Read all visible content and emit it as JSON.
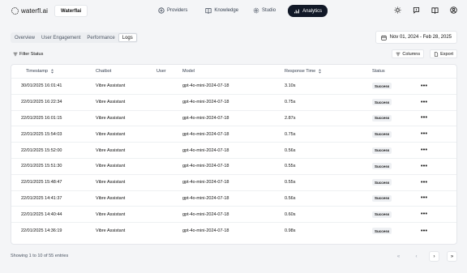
{
  "brand": {
    "logo_text": "waterfl.ai",
    "workspace": "Waterflai"
  },
  "nav": {
    "items": [
      {
        "label": "Providers",
        "icon": "circle-plus-icon"
      },
      {
        "label": "Knowledge",
        "icon": "book-icon"
      },
      {
        "label": "Studio",
        "icon": "gear-icon"
      },
      {
        "label": "Analytics",
        "icon": "chart-icon",
        "active": true
      }
    ]
  },
  "top_icons": [
    "sun-icon",
    "chat-alert-icon",
    "book-open-icon",
    "user-circle-icon"
  ],
  "tabs": [
    {
      "label": "Overview"
    },
    {
      "label": "User Engagement"
    },
    {
      "label": "Performance"
    },
    {
      "label": "Logs",
      "active": true
    }
  ],
  "date_range": "Nov 01, 2024 - Feb 28, 2025",
  "toolbar": {
    "filter_label": "Filter Status",
    "columns_label": "Columns",
    "export_label": "Export"
  },
  "table": {
    "headers": [
      "Timestamp",
      "Chatbot",
      "User",
      "Model",
      "Response Time",
      "Status"
    ],
    "rows": [
      {
        "timestamp": "30/01/2025 16:01:41",
        "chatbot": "Vibre Assistant",
        "user": "",
        "model": "gpt-4o-mini-2024-07-18",
        "response_time": "3.10s",
        "status": "Success"
      },
      {
        "timestamp": "22/01/2025 16:22:34",
        "chatbot": "Vibre Assistant",
        "user": "",
        "model": "gpt-4o-mini-2024-07-18",
        "response_time": "0.75s",
        "status": "Success"
      },
      {
        "timestamp": "22/01/2025 16:01:15",
        "chatbot": "Vibre Assistant",
        "user": "",
        "model": "gpt-4o-mini-2024-07-18",
        "response_time": "2.87s",
        "status": "Success"
      },
      {
        "timestamp": "22/01/2025 15:54:03",
        "chatbot": "Vibre Assistant",
        "user": "",
        "model": "gpt-4o-mini-2024-07-18",
        "response_time": "0.75s",
        "status": "Success"
      },
      {
        "timestamp": "22/01/2025 15:52:00",
        "chatbot": "Vibre Assistant",
        "user": "",
        "model": "gpt-4o-mini-2024-07-18",
        "response_time": "0.56s",
        "status": "Success"
      },
      {
        "timestamp": "22/01/2025 15:51:30",
        "chatbot": "Vibre Assistant",
        "user": "",
        "model": "gpt-4o-mini-2024-07-18",
        "response_time": "0.55s",
        "status": "Success"
      },
      {
        "timestamp": "22/01/2025 15:48:47",
        "chatbot": "Vibre Assistant",
        "user": "",
        "model": "gpt-4o-mini-2024-07-18",
        "response_time": "0.55s",
        "status": "Success"
      },
      {
        "timestamp": "22/01/2025 14:41:37",
        "chatbot": "Vibre Assistant",
        "user": "",
        "model": "gpt-4o-mini-2024-07-18",
        "response_time": "0.56s",
        "status": "Success"
      },
      {
        "timestamp": "22/01/2025 14:40:44",
        "chatbot": "Vibre Assistant",
        "user": "",
        "model": "gpt-4o-mini-2024-07-18",
        "response_time": "0.60s",
        "status": "Success"
      },
      {
        "timestamp": "22/01/2025 14:36:19",
        "chatbot": "Vibre Assistant",
        "user": "",
        "model": "gpt-4o-mini-2024-07-18",
        "response_time": "0.98s",
        "status": "Success"
      }
    ],
    "row_menu_glyph": "•••"
  },
  "footer": {
    "showing": "Showing 1 to 10 of 55 entries",
    "pager": [
      {
        "glyph": "«",
        "name": "first-page-button",
        "enabled": false
      },
      {
        "glyph": "‹",
        "name": "prev-page-button",
        "enabled": false
      },
      {
        "glyph": "›",
        "name": "next-page-button",
        "enabled": true
      },
      {
        "glyph": "»",
        "name": "last-page-button",
        "enabled": true
      }
    ]
  },
  "colors": {
    "accent": "#111827",
    "background": "#f4f5f7",
    "badge_bg": "#eef0f3"
  }
}
